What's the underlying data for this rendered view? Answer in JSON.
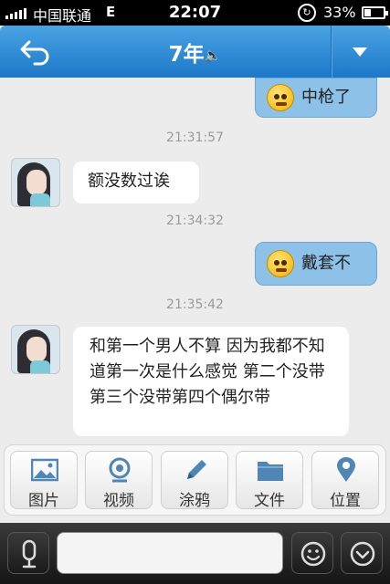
{
  "status_bar": {
    "carrier": "中国联通",
    "network": "E",
    "time": "22:07",
    "battery_percent": "33%",
    "battery_level": 0.33
  },
  "header": {
    "title": "7年",
    "speaker_glyph": "🔈"
  },
  "messages": [
    {
      "side": "right",
      "emoji": "shocked-emoji",
      "text": "中枪了"
    },
    {
      "timestamp": "21:31:57"
    },
    {
      "side": "left",
      "text": "额没数过诶"
    },
    {
      "timestamp": "21:34:32"
    },
    {
      "side": "right",
      "emoji": "smirk-emoji",
      "text": "戴套不"
    },
    {
      "timestamp": "21:35:42"
    },
    {
      "side": "left",
      "text": "和第一个男人不算  因为我都不知道第一次是什么感觉   第二个没带第三个没带第四个偶尔带"
    }
  ],
  "actions": [
    {
      "label": "图片",
      "icon": "image-icon"
    },
    {
      "label": "视频",
      "icon": "video-icon"
    },
    {
      "label": "涂鸦",
      "icon": "pencil-icon"
    },
    {
      "label": "文件",
      "icon": "folder-icon"
    },
    {
      "label": "位置",
      "icon": "location-pin-icon"
    }
  ],
  "colors": {
    "header_blue": "#1c78c9",
    "outgoing_bubble": "#8ec1e8",
    "incoming_bubble": "#ffffff",
    "action_icon_blue": "#4f86b5"
  }
}
